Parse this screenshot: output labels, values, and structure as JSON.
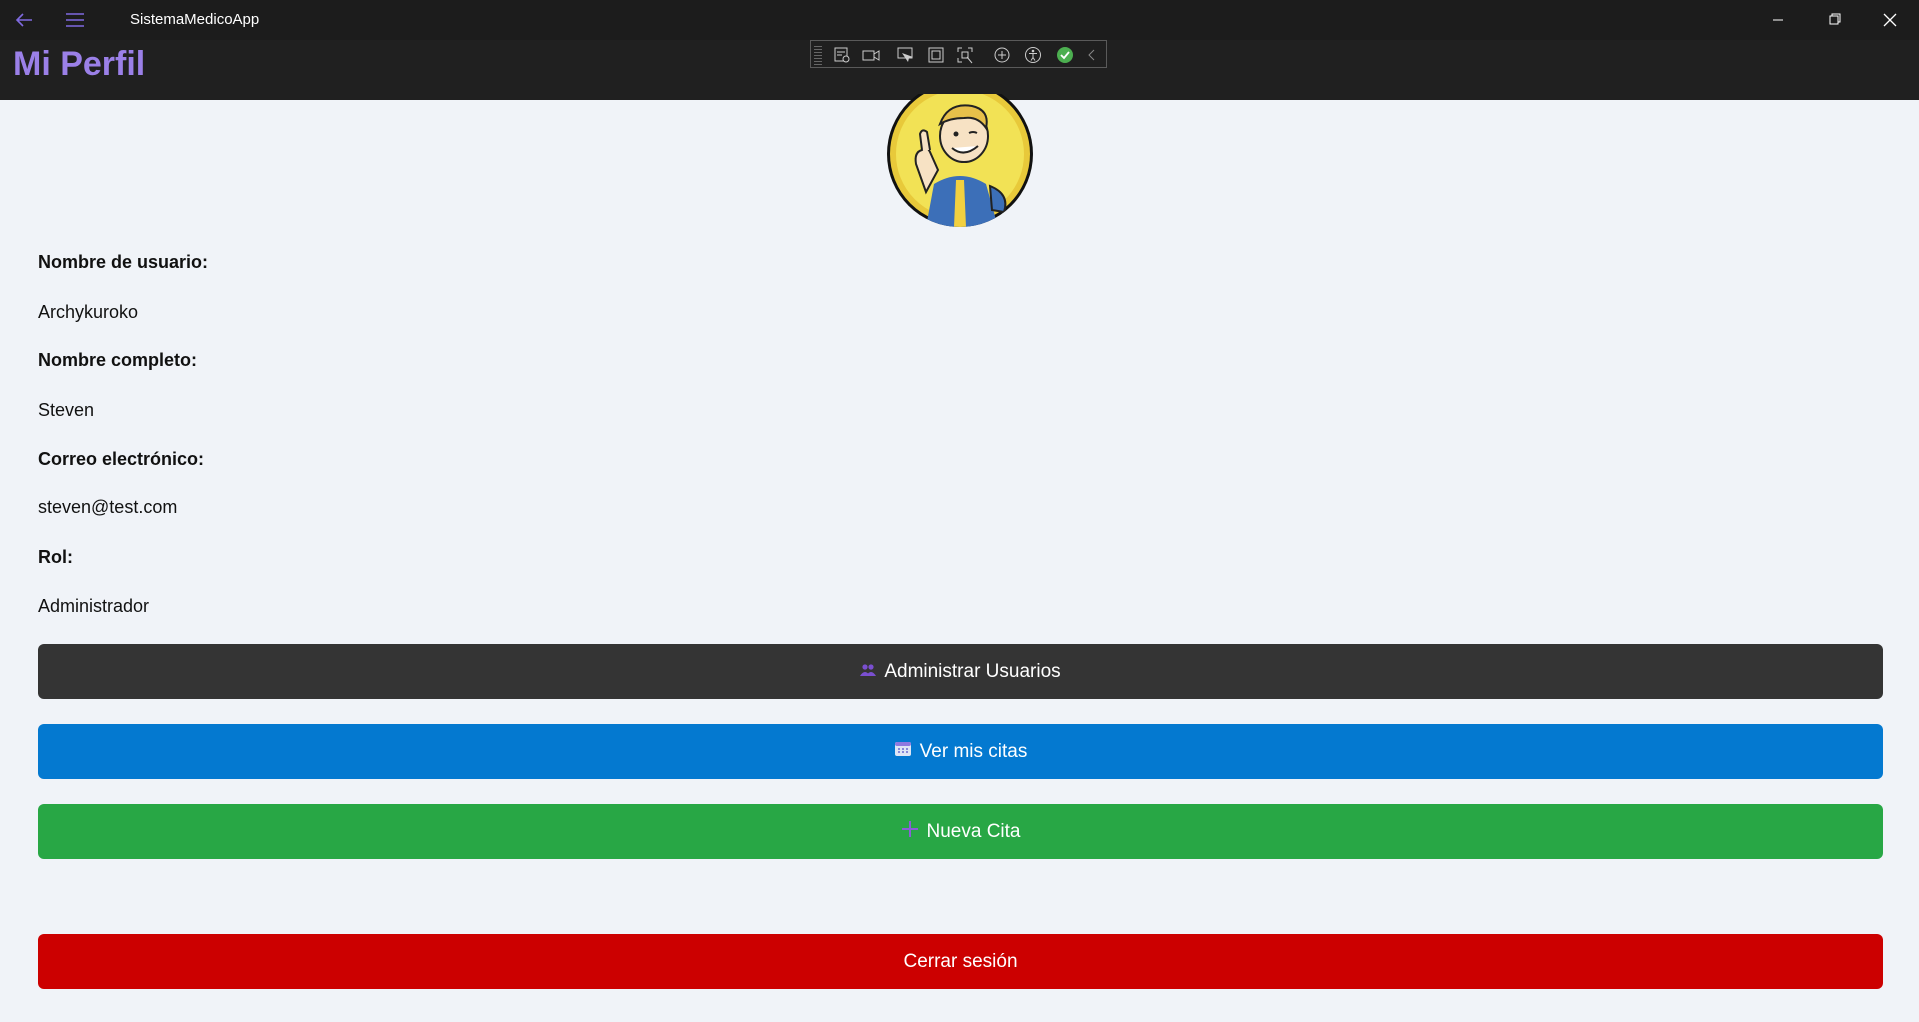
{
  "window": {
    "app_title": "SistemaMedicoApp",
    "controls": [
      "minimize",
      "restore",
      "close"
    ]
  },
  "header": {
    "page_title": "Mi Perfil",
    "accent_color": "#9b80e8"
  },
  "devtools": {
    "icons": [
      "live-visual-tree-icon",
      "record-icon",
      "select-element-icon",
      "display-layout-adorners-icon",
      "track-focus-icon",
      "binding-failures-icon",
      "accessibility-icon",
      "check-icon",
      "collapse-icon"
    ]
  },
  "profile": {
    "avatar": "vault-boy-avatar",
    "fields": [
      {
        "label": "Nombre de usuario:",
        "value": "Archykuroko"
      },
      {
        "label": "Nombre completo:",
        "value": "Steven"
      },
      {
        "label": "Correo electrónico:",
        "value": "steven@test.com"
      },
      {
        "label": "Rol:",
        "value": "Administrador"
      }
    ]
  },
  "actions": {
    "admin_users": {
      "label": "Administrar Usuarios",
      "icon": "users-icon",
      "color": "#343434"
    },
    "my_appointments": {
      "label": "Ver mis citas",
      "icon": "calendar-icon",
      "color": "#0479d0"
    },
    "new_appointment": {
      "label": "Nueva Cita",
      "icon": "plus-icon",
      "color": "#28a745"
    },
    "logout": {
      "label": "Cerrar sesión",
      "color": "#cc0000"
    }
  }
}
